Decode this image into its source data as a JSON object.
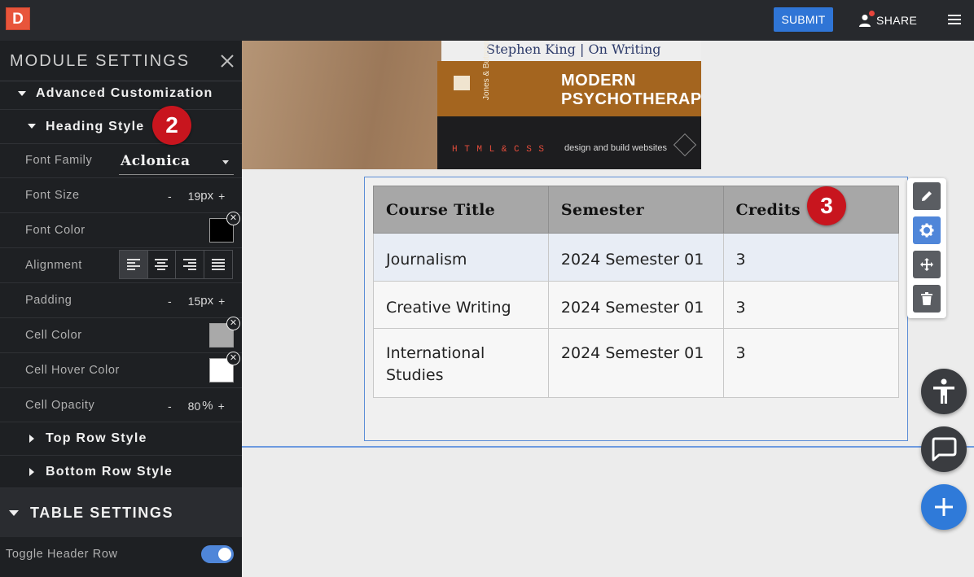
{
  "topbar": {
    "logo_letter": "D",
    "submit_label": "SUBMIT",
    "share_label": "SHARE"
  },
  "sidebar": {
    "title": "MODULE SETTINGS",
    "advanced_label": "Advanced Customization",
    "heading_style_label": "Heading Style",
    "fields": {
      "font_family_label": "Font Family",
      "font_family_value": "Aclonica",
      "font_size_label": "Font Size",
      "font_size_value": "19",
      "font_size_unit": "px",
      "font_color_label": "Font Color",
      "font_color": "#000000",
      "alignment_label": "Alignment",
      "padding_label": "Padding",
      "padding_value": "15",
      "padding_unit": "px",
      "cell_color_label": "Cell Color",
      "cell_color": "#a9a9a9",
      "cell_hover_label": "Cell Hover Color",
      "cell_hover_color": "#ffffff",
      "cell_opacity_label": "Cell Opacity",
      "cell_opacity_value": "80",
      "cell_opacity_unit": "%"
    },
    "minus": "-",
    "plus": "+",
    "clear_symbol": "✕",
    "top_row_label": "Top Row Style",
    "bottom_row_label": "Bottom Row Style",
    "table_settings_label": "TABLE SETTINGS",
    "toggle_header_label": "Toggle Header Row",
    "toggle_header_on": true
  },
  "badges": {
    "heading": "2",
    "table": "3"
  },
  "hero": {
    "book1": "Stephen King | On Writing",
    "book2_author": "Jones & Butman",
    "book2_title_1": "MODERN",
    "book2_title_2": "PSYCHOTHERAPI",
    "book3_code": "H T M L & C S S",
    "book3_sub": "design and build websites"
  },
  "table": {
    "headers": [
      "Course Title",
      "Semester",
      "Credits"
    ],
    "rows": [
      [
        "Journalism",
        "2024 Semester 01",
        "3"
      ],
      [
        "Creative Writing",
        "2024 Semester 01",
        "3"
      ],
      [
        "International Studies",
        "2024 Semester 01",
        "3"
      ]
    ]
  },
  "colors": {
    "accent": "#2f75d6",
    "badge": "#c8151e",
    "sidebar_bg": "#1e2023",
    "header_cell": "#a7a7a7"
  },
  "tools": [
    "edit-icon",
    "gear-icon",
    "move-icon",
    "trash-icon"
  ],
  "fabs": [
    "accessibility-icon",
    "chat-icon",
    "plus-icon"
  ]
}
